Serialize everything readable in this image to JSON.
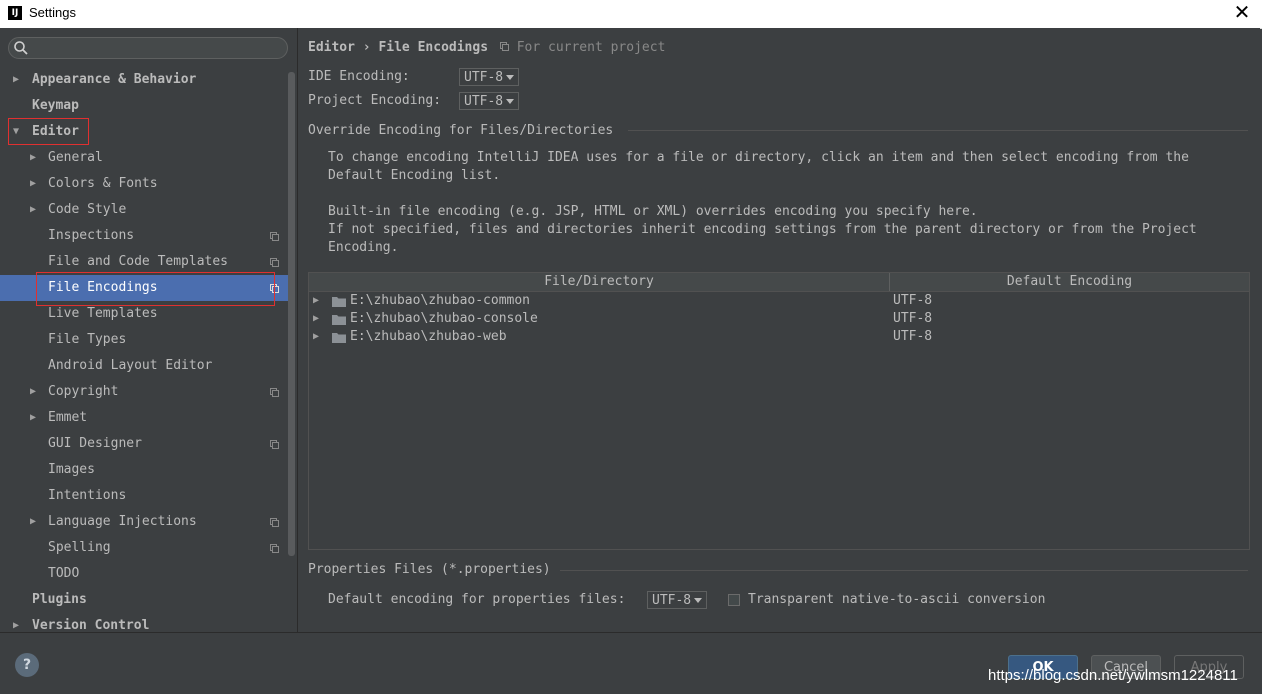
{
  "window": {
    "title": "Settings",
    "app_icon": "IJ"
  },
  "search": {
    "placeholder": ""
  },
  "sidebar": {
    "items": [
      {
        "label": "Appearance & Behavior",
        "arrow": "▶"
      },
      {
        "label": "Keymap"
      },
      {
        "label": "Editor",
        "arrow": "▼"
      },
      {
        "label": "General",
        "arrow": "▶"
      },
      {
        "label": "Colors & Fonts",
        "arrow": "▶"
      },
      {
        "label": "Code Style",
        "arrow": "▶"
      },
      {
        "label": "Inspections"
      },
      {
        "label": "File and Code Templates"
      },
      {
        "label": "File Encodings"
      },
      {
        "label": "Live Templates"
      },
      {
        "label": "File Types"
      },
      {
        "label": "Android Layout Editor"
      },
      {
        "label": "Copyright",
        "arrow": "▶"
      },
      {
        "label": "Emmet",
        "arrow": "▶"
      },
      {
        "label": "GUI Designer"
      },
      {
        "label": "Images"
      },
      {
        "label": "Intentions"
      },
      {
        "label": "Language Injections",
        "arrow": "▶"
      },
      {
        "label": "Spelling"
      },
      {
        "label": "TODO"
      },
      {
        "label": "Plugins"
      },
      {
        "label": "Version Control",
        "arrow": "▶"
      }
    ]
  },
  "breadcrumb": {
    "parent": "Editor",
    "separator": "›",
    "current": "File Encodings",
    "scope": "For current project"
  },
  "encoding": {
    "ide_label": "IDE Encoding:",
    "ide_value": "UTF-8",
    "project_label": "Project Encoding:",
    "project_value": "UTF-8"
  },
  "override": {
    "title": "Override Encoding for Files/Directories",
    "para1_line1": "To change encoding IntelliJ IDEA uses for a file or directory, click an item and then select encoding from the",
    "para1_line2": "Default Encoding list.",
    "para2_line1": "Built-in file encoding (e.g. JSP, HTML or XML) overrides encoding you specify here.",
    "para2_line2": "If not specified, files and directories inherit encoding settings from the parent directory or from the Project",
    "para2_line3": "Encoding."
  },
  "table": {
    "columns": [
      "File/Directory",
      "Default Encoding"
    ],
    "rows": [
      {
        "path": "E:\\zhubao\\zhubao-common",
        "encoding": "UTF-8"
      },
      {
        "path": "E:\\zhubao\\zhubao-console",
        "encoding": "UTF-8"
      },
      {
        "path": "E:\\zhubao\\zhubao-web",
        "encoding": "UTF-8"
      }
    ]
  },
  "properties": {
    "title": "Properties Files (*.properties)",
    "default_label": "Default encoding for properties files:",
    "default_value": "UTF-8",
    "transparent_label": "Transparent native-to-ascii conversion",
    "transparent_checked": false
  },
  "buttons": {
    "ok": "OK",
    "cancel": "Cancel",
    "apply": "Apply"
  },
  "watermark": "https://blog.csdn.net/ywlmsm1224811",
  "colors": {
    "selection": "#4b6eaf",
    "highlight_box": "#e03030",
    "background": "#3c3f41"
  }
}
